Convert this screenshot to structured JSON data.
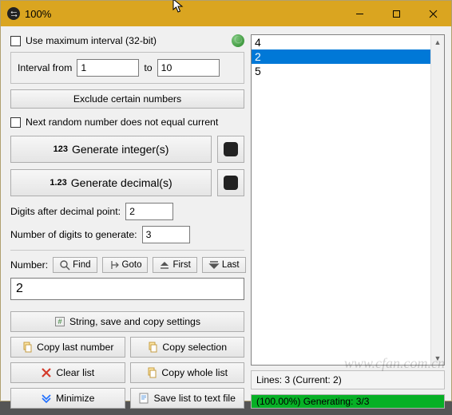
{
  "window": {
    "title": "100%"
  },
  "left": {
    "use_max_interval_label": "Use maximum interval (32-bit)",
    "interval_from_label": "Interval from",
    "interval_from_value": "1",
    "interval_to_label": "to",
    "interval_to_value": "10",
    "exclude_label": "Exclude certain numbers",
    "no_repeat_label": "Next random number does not equal current",
    "gen_int_prefix": "123",
    "gen_int_label": "Generate integer(s)",
    "gen_dec_prefix": "1.23",
    "gen_dec_label": "Generate decimal(s)",
    "digits_after_label": "Digits after decimal point:",
    "digits_after_value": "2",
    "digits_generate_label": "Number of digits to generate:",
    "digits_generate_value": "3",
    "number_label": "Number:",
    "find_label": "Find",
    "goto_label": "Goto",
    "first_label": "First",
    "last_label": "Last",
    "number_value": "2",
    "string_settings_label": "String, save and copy settings",
    "copy_last_label": "Copy last number",
    "copy_selection_label": "Copy selection",
    "clear_list_label": "Clear list",
    "copy_whole_label": "Copy whole list",
    "minimize_label": "Minimize",
    "save_list_label": "Save list to text file"
  },
  "right": {
    "items": [
      "4",
      "2",
      "5"
    ],
    "selected_index": 1,
    "status_line": "Lines: 3 (Current: 2)",
    "progress_text": "(100.00%) Generating: 3/3",
    "progress_pct": 100
  },
  "watermark": "www.cfan.com.cn"
}
